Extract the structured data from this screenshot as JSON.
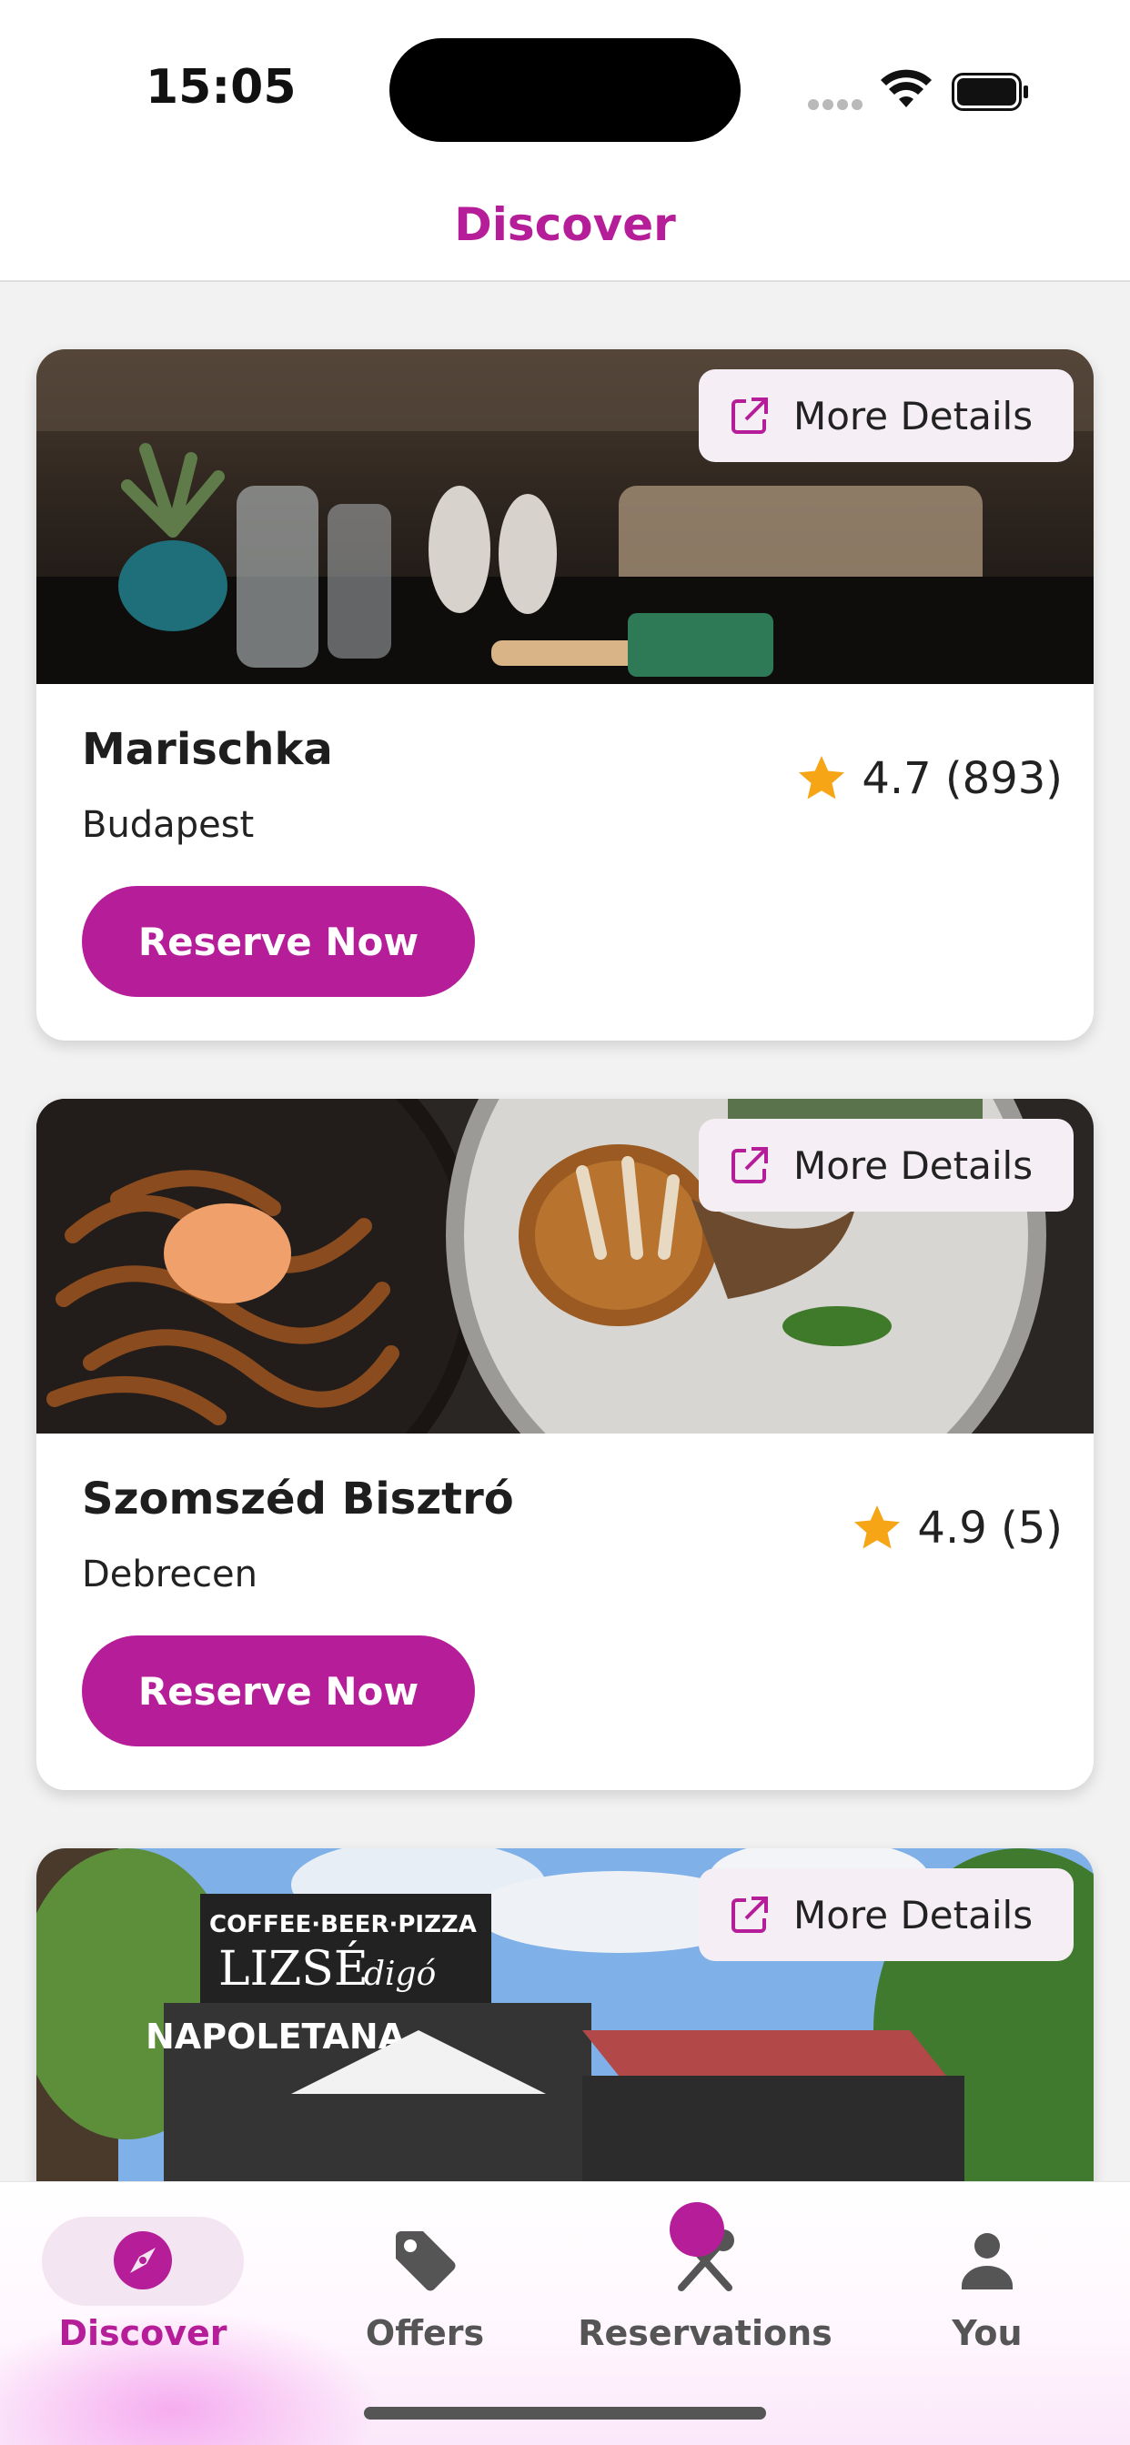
{
  "status_bar": {
    "time": "15:05"
  },
  "header": {
    "title": "Discover"
  },
  "colors": {
    "accent": "#b51d99",
    "star": "#f5a516",
    "details_bg": "#f6eef5"
  },
  "restaurants": [
    {
      "name": "Marischka",
      "city": "Budapest",
      "rating": "4.7 (893)",
      "details_label": "More Details",
      "reserve_label": "Reserve Now"
    },
    {
      "name": "Szomszéd Bisztró",
      "city": "Debrecen",
      "rating": "4.9 (5)",
      "details_label": "More Details",
      "reserve_label": "Reserve Now"
    },
    {
      "name": "",
      "city": "",
      "rating": "",
      "details_label": "More Details",
      "reserve_label": "",
      "photo_sign_lines": [
        "COFFEE·BEER·PIZZA",
        "LIZSÉ",
        "digó",
        "NAPOLETANA"
      ]
    }
  ],
  "bottom_nav": {
    "items": [
      {
        "label": "Discover",
        "icon": "compass-icon",
        "active": true
      },
      {
        "label": "Offers",
        "icon": "tag-icon",
        "active": false
      },
      {
        "label": "Reservations",
        "icon": "cutlery-icon",
        "active": false,
        "badge": true
      },
      {
        "label": "You",
        "icon": "person-icon",
        "active": false
      }
    ]
  }
}
